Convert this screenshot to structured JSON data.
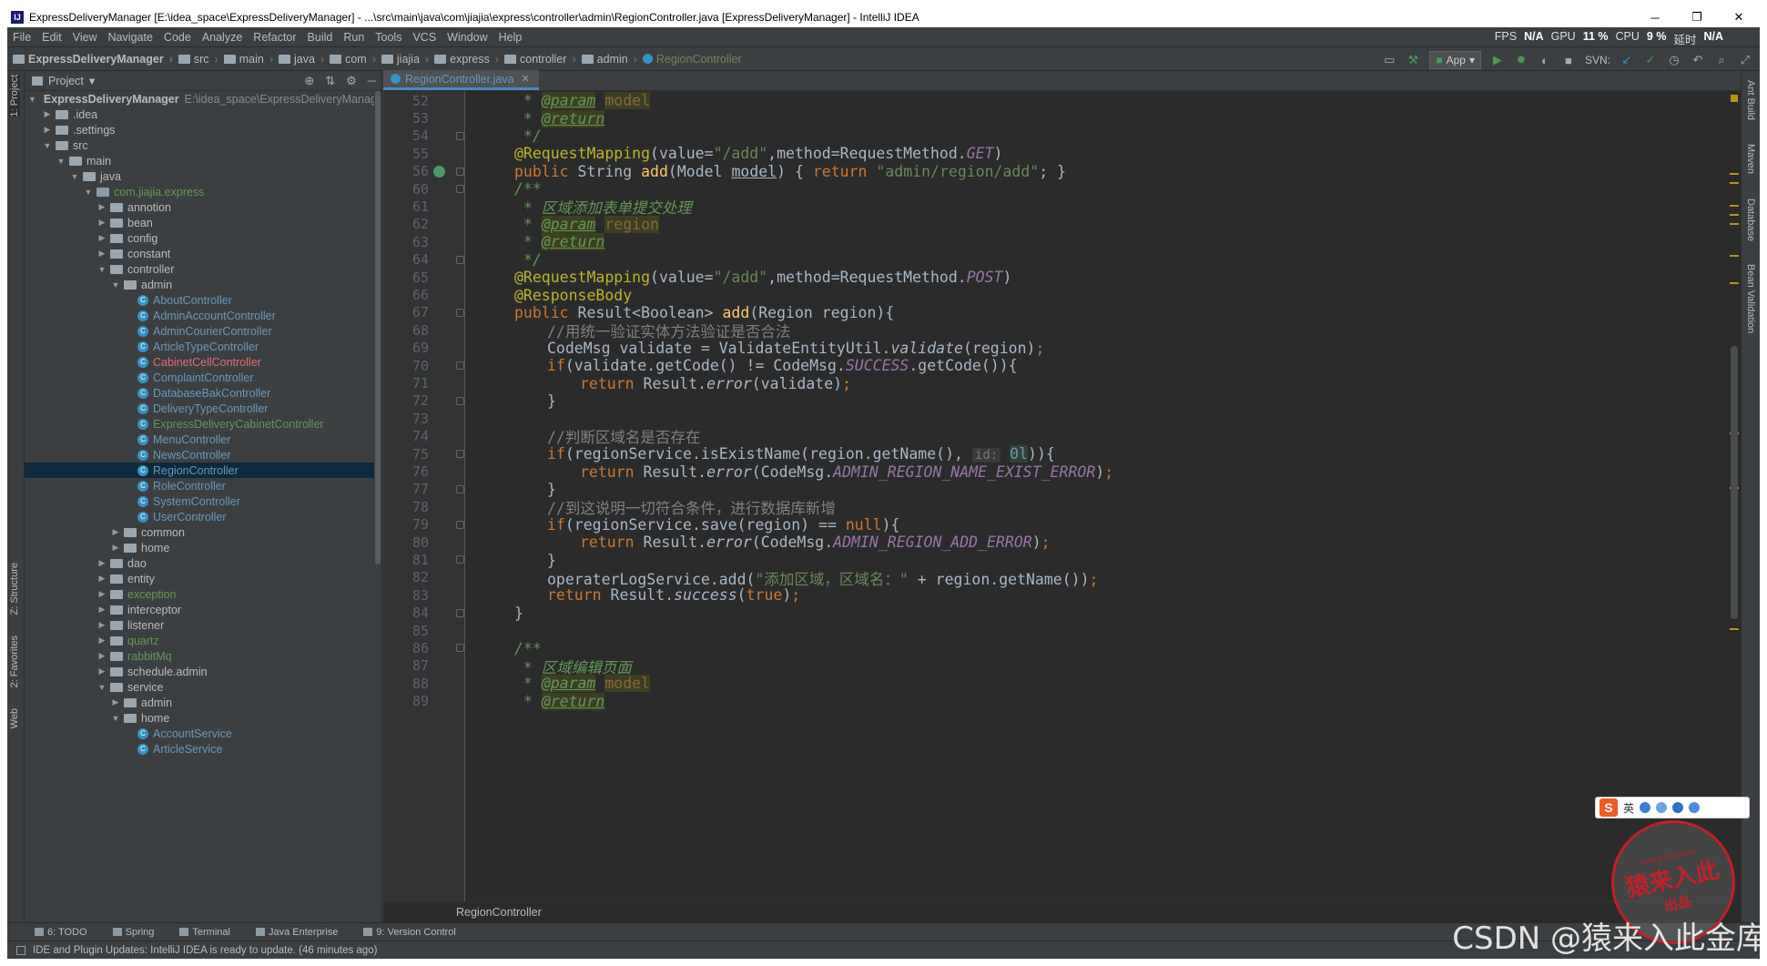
{
  "titlebar": {
    "title": "ExpressDeliveryManager [E:\\idea_space\\ExpressDeliveryManager] - ...\\src\\main\\java\\com\\jiajia\\express\\controller\\admin\\RegionController.java [ExpressDeliveryManager] - IntelliJ IDEA",
    "minimize": "─",
    "maximize": "❐",
    "close": "✕"
  },
  "menu": {
    "items": [
      "File",
      "Edit",
      "View",
      "Navigate",
      "Code",
      "Analyze",
      "Refactor",
      "Build",
      "Run",
      "Tools",
      "VCS",
      "Window",
      "Help"
    ],
    "perf": {
      "fps_label": "FPS",
      "fps": "N/A",
      "gpu_label": "GPU",
      "gpu": "11 %",
      "cpu_label": "CPU",
      "cpu": "9 %",
      "lat_label": "延时",
      "lat": "N/A"
    }
  },
  "navbar": {
    "crumbs": [
      "ExpressDeliveryManager",
      "src",
      "main",
      "java",
      "com",
      "jiajia",
      "express",
      "controller",
      "admin",
      "RegionController"
    ],
    "run_config": "App",
    "svn_label": "SVN:"
  },
  "left_strip": {
    "project": "1: Project",
    "structure": "Z: Structure",
    "favorites": "2: Favorites",
    "web": "Web"
  },
  "right_strip": {
    "ant": "Ant Build",
    "maven": "Maven",
    "database": "Database",
    "bean": "Bean Validation"
  },
  "project": {
    "header": "Project",
    "root_path": "E:\\idea_space\\ExpressDeliveryManager",
    "tree": [
      {
        "label": "ExpressDeliveryManager",
        "depth": 0,
        "kind": "root",
        "open": true
      },
      {
        "label": ".idea",
        "depth": 1,
        "kind": "folder",
        "open": false
      },
      {
        "label": ".settings",
        "depth": 1,
        "kind": "folder",
        "open": false
      },
      {
        "label": "src",
        "depth": 1,
        "kind": "folder",
        "open": true
      },
      {
        "label": "main",
        "depth": 2,
        "kind": "folder",
        "open": true
      },
      {
        "label": "java",
        "depth": 3,
        "kind": "folder",
        "open": true
      },
      {
        "label": "com.jiajia.express",
        "depth": 4,
        "kind": "pkg",
        "open": true,
        "color": "green"
      },
      {
        "label": "annotion",
        "depth": 5,
        "kind": "folder",
        "open": false
      },
      {
        "label": "bean",
        "depth": 5,
        "kind": "folder",
        "open": false
      },
      {
        "label": "config",
        "depth": 5,
        "kind": "folder",
        "open": false
      },
      {
        "label": "constant",
        "depth": 5,
        "kind": "folder",
        "open": false
      },
      {
        "label": "controller",
        "depth": 5,
        "kind": "folder",
        "open": true
      },
      {
        "label": "admin",
        "depth": 6,
        "kind": "folder",
        "open": true
      },
      {
        "label": "AboutController",
        "depth": 7,
        "kind": "class",
        "color": "blue"
      },
      {
        "label": "AdminAccountController",
        "depth": 7,
        "kind": "class",
        "color": "blue"
      },
      {
        "label": "AdminCourierController",
        "depth": 7,
        "kind": "class",
        "color": "blue"
      },
      {
        "label": "ArticleTypeController",
        "depth": 7,
        "kind": "class",
        "color": "blue"
      },
      {
        "label": "CabinetCellController",
        "depth": 7,
        "kind": "class",
        "color": "red"
      },
      {
        "label": "ComplaintController",
        "depth": 7,
        "kind": "class",
        "color": "blue"
      },
      {
        "label": "DatabaseBakController",
        "depth": 7,
        "kind": "class",
        "color": "blue"
      },
      {
        "label": "DeliveryTypeController",
        "depth": 7,
        "kind": "class",
        "color": "blue"
      },
      {
        "label": "ExpressDeliveryCabinetController",
        "depth": 7,
        "kind": "class",
        "color": "green"
      },
      {
        "label": "MenuController",
        "depth": 7,
        "kind": "class",
        "color": "blue"
      },
      {
        "label": "NewsController",
        "depth": 7,
        "kind": "class",
        "color": "blue"
      },
      {
        "label": "RegionController",
        "depth": 7,
        "kind": "class",
        "color": "blue",
        "selected": true
      },
      {
        "label": "RoleController",
        "depth": 7,
        "kind": "class",
        "color": "blue"
      },
      {
        "label": "SystemController",
        "depth": 7,
        "kind": "class",
        "color": "blue"
      },
      {
        "label": "UserController",
        "depth": 7,
        "kind": "class",
        "color": "blue"
      },
      {
        "label": "common",
        "depth": 6,
        "kind": "folder",
        "open": false
      },
      {
        "label": "home",
        "depth": 6,
        "kind": "folder",
        "open": false
      },
      {
        "label": "dao",
        "depth": 5,
        "kind": "folder",
        "open": false
      },
      {
        "label": "entity",
        "depth": 5,
        "kind": "folder",
        "open": false
      },
      {
        "label": "exception",
        "depth": 5,
        "kind": "folder",
        "open": false,
        "color": "green"
      },
      {
        "label": "interceptor",
        "depth": 5,
        "kind": "folder",
        "open": false
      },
      {
        "label": "listener",
        "depth": 5,
        "kind": "folder",
        "open": false
      },
      {
        "label": "quartz",
        "depth": 5,
        "kind": "folder",
        "open": false,
        "color": "green"
      },
      {
        "label": "rabbitMq",
        "depth": 5,
        "kind": "folder",
        "open": false,
        "color": "green"
      },
      {
        "label": "schedule.admin",
        "depth": 5,
        "kind": "folder",
        "open": false
      },
      {
        "label": "service",
        "depth": 5,
        "kind": "folder",
        "open": true
      },
      {
        "label": "admin",
        "depth": 6,
        "kind": "folder",
        "open": false
      },
      {
        "label": "home",
        "depth": 6,
        "kind": "folder",
        "open": true
      },
      {
        "label": "AccountService",
        "depth": 7,
        "kind": "class",
        "color": "blue"
      },
      {
        "label": "ArticleService",
        "depth": 7,
        "kind": "class",
        "color": "blue"
      }
    ]
  },
  "editor": {
    "tab": "RegionController.java",
    "breadcrumb": "RegionController",
    "lines": [
      {
        "n": "52",
        "ind": 1,
        "h": "<span class='cm'> * </span><span class='tag'>@param</span> <span class='pv'>model</span>"
      },
      {
        "n": "53",
        "ind": 1,
        "h": "<span class='cm'> * </span><span class='tag'>@return</span>"
      },
      {
        "n": "54",
        "ind": 1,
        "h": "<span class='cm'> */</span>",
        "fold": true
      },
      {
        "n": "55",
        "ind": 1,
        "h": "<span class='ann'>@RequestMapping</span>(value=<span class='str'>\"/add\"</span>,method=RequestMethod.<span class='fld'>GET</span>)"
      },
      {
        "n": "56",
        "ind": 1,
        "h": "<span class='kw'>public</span> String <span class='mtd'>add</span>(Model <u>model</u>) { <span class='kw'>return</span> <span class='str'>\"admin/region/add\"</span>; }",
        "bean": true,
        "fold": true
      },
      {
        "n": "60",
        "ind": 1,
        "h": "<span class='cm'>/**</span>",
        "fold": true
      },
      {
        "n": "61",
        "ind": 1,
        "h": "<span class='cm'> * 区域添加表单提交处理</span>"
      },
      {
        "n": "62",
        "ind": 1,
        "h": "<span class='cm'> * </span><span class='tag'>@param</span> <span class='pv'>region</span>"
      },
      {
        "n": "63",
        "ind": 1,
        "h": "<span class='cm'> * </span><span class='tag'>@return</span>"
      },
      {
        "n": "64",
        "ind": 1,
        "h": "<span class='cm'> */</span>",
        "fold": true
      },
      {
        "n": "65",
        "ind": 1,
        "h": "<span class='ann'>@RequestMapping</span>(value=<span class='str'>\"/add\"</span>,method=RequestMethod.<span class='fld'>POST</span>)"
      },
      {
        "n": "66",
        "ind": 1,
        "h": "<span class='ann'>@ResponseBody</span>"
      },
      {
        "n": "67",
        "ind": 1,
        "h": "<span class='kw'>public</span> Result&lt;Boolean&gt; <span class='mtd'>add</span>(Region region){",
        "fold": true
      },
      {
        "n": "68",
        "ind": 2,
        "h": "<span class='lc'>//用统一验证实体方法验证是否合法</span>"
      },
      {
        "n": "69",
        "ind": 2,
        "h": "CodeMsg validate = ValidateEntityUtil.<i>validate</i>(region)<span class='kw'>;</span>"
      },
      {
        "n": "70",
        "ind": 2,
        "h": "<span class='kw'>if</span>(validate.getCode() != CodeMsg.<span class='fld'>SUCCESS</span>.getCode()){",
        "fold": true
      },
      {
        "n": "71",
        "ind": 3,
        "h": "<span class='kw'>return</span> Result.<i>error</i>(validate)<span class='kw'>;</span>"
      },
      {
        "n": "72",
        "ind": 2,
        "h": "}",
        "fold": true
      },
      {
        "n": "73",
        "ind": 0,
        "h": ""
      },
      {
        "n": "74",
        "ind": 2,
        "h": "<span class='lc'>//判断区域名是否存在</span>"
      },
      {
        "n": "75",
        "ind": 2,
        "h": "<span class='kw'>if</span>(regionService.isExistName(region.getName(), <span class='hint'>id:</span> <span class='num'>0l</span>)){",
        "fold": true
      },
      {
        "n": "76",
        "ind": 3,
        "h": "<span class='kw'>return</span> Result.<i>error</i>(CodeMsg.<span class='fld'>ADMIN_REGION_NAME_EXIST_ERROR</span>)<span class='kw'>;</span>"
      },
      {
        "n": "77",
        "ind": 2,
        "h": "}",
        "fold": true
      },
      {
        "n": "78",
        "ind": 2,
        "h": "<span class='lc'>//到这说明一切符合条件，进行数据库新增</span>"
      },
      {
        "n": "79",
        "ind": 2,
        "h": "<span class='kw'>if</span>(regionService.save(region) == <span class='kw'>null</span>){",
        "fold": true
      },
      {
        "n": "80",
        "ind": 3,
        "h": "<span class='kw'>return</span> Result.<i>error</i>(CodeMsg.<span class='fld'>ADMIN_REGION_ADD_ERROR</span>)<span class='kw'>;</span>"
      },
      {
        "n": "81",
        "ind": 2,
        "h": "}",
        "fold": true
      },
      {
        "n": "82",
        "ind": 2,
        "h": "operaterLogService.add(<span class='str'>\"添加区域，区域名：\"</span> + region.getName())<span class='kw'>;</span>"
      },
      {
        "n": "83",
        "ind": 2,
        "h": "<span class='kw'>return</span> Result.<i>success</i>(<span class='kw'>true</span>)<span class='kw'>;</span>"
      },
      {
        "n": "84",
        "ind": 1,
        "h": "}",
        "fold": true
      },
      {
        "n": "85",
        "ind": 0,
        "h": ""
      },
      {
        "n": "86",
        "ind": 1,
        "h": "<span class='cm'>/**</span>",
        "fold": true
      },
      {
        "n": "87",
        "ind": 1,
        "h": "<span class='cm'> * 区域编辑页面</span>"
      },
      {
        "n": "88",
        "ind": 1,
        "h": "<span class='cm'> * </span><span class='tag'>@param</span> <span class='pv'>model</span>"
      },
      {
        "n": "89",
        "ind": 1,
        "h": "<span class='cm'> * </span><span class='tag'>@return</span>"
      }
    ]
  },
  "bottom_tools": [
    "6: TODO",
    "Spring",
    "Terminal",
    "Java Enterprise",
    "9: Version Control"
  ],
  "status": "IDE and Plugin Updates: IntelliJ IDEA is ready to update. (46 minutes ago)",
  "overlays": {
    "watermark": "CSDN @猿来入此金库",
    "ime": {
      "logo": "S",
      "mode": "英"
    },
    "stamp": {
      "big": "猿来入此",
      "small": "出品",
      "url": "www.yuanrc.com"
    }
  }
}
